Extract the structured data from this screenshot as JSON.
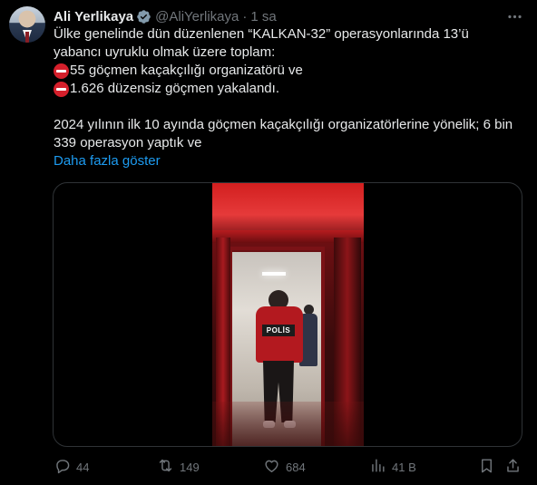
{
  "author": {
    "name": "Ali Yerlikaya",
    "handle": "@AliYerlikaya",
    "separator": "·",
    "time": "1 sa"
  },
  "tweet": {
    "lines": [
      "Ülke genelinde dün düzenlenen “KALKAN-32” operasyonlarında 13’ü",
      "yabancı uyruklu olmak üzere toplam:",
      "55 göçmen kaçakçılığı organizatörü ve",
      "1.626 düzensiz göçmen yakalandı.",
      "2024 yılının ilk 10 ayında göçmen kaçakçılığı organizatörlerine yönelik; 6 bin",
      "339 operasyon yaptık ve"
    ],
    "show_more": "Daha fazla göster"
  },
  "media": {
    "vest_text": "POLİS"
  },
  "actions": {
    "replies": "44",
    "reposts": "149",
    "likes": "684",
    "views": "41 B"
  },
  "colors": {
    "background": "#000000",
    "text": "#e7e9ea",
    "muted": "#71767b",
    "link": "#1d9bf0",
    "verified": "#829aab"
  },
  "icons": [
    "more-icon",
    "verified-badge-icon",
    "no-entry-icon",
    "reply-icon",
    "repost-icon",
    "like-icon",
    "views-icon",
    "bookmark-icon",
    "share-icon"
  ]
}
